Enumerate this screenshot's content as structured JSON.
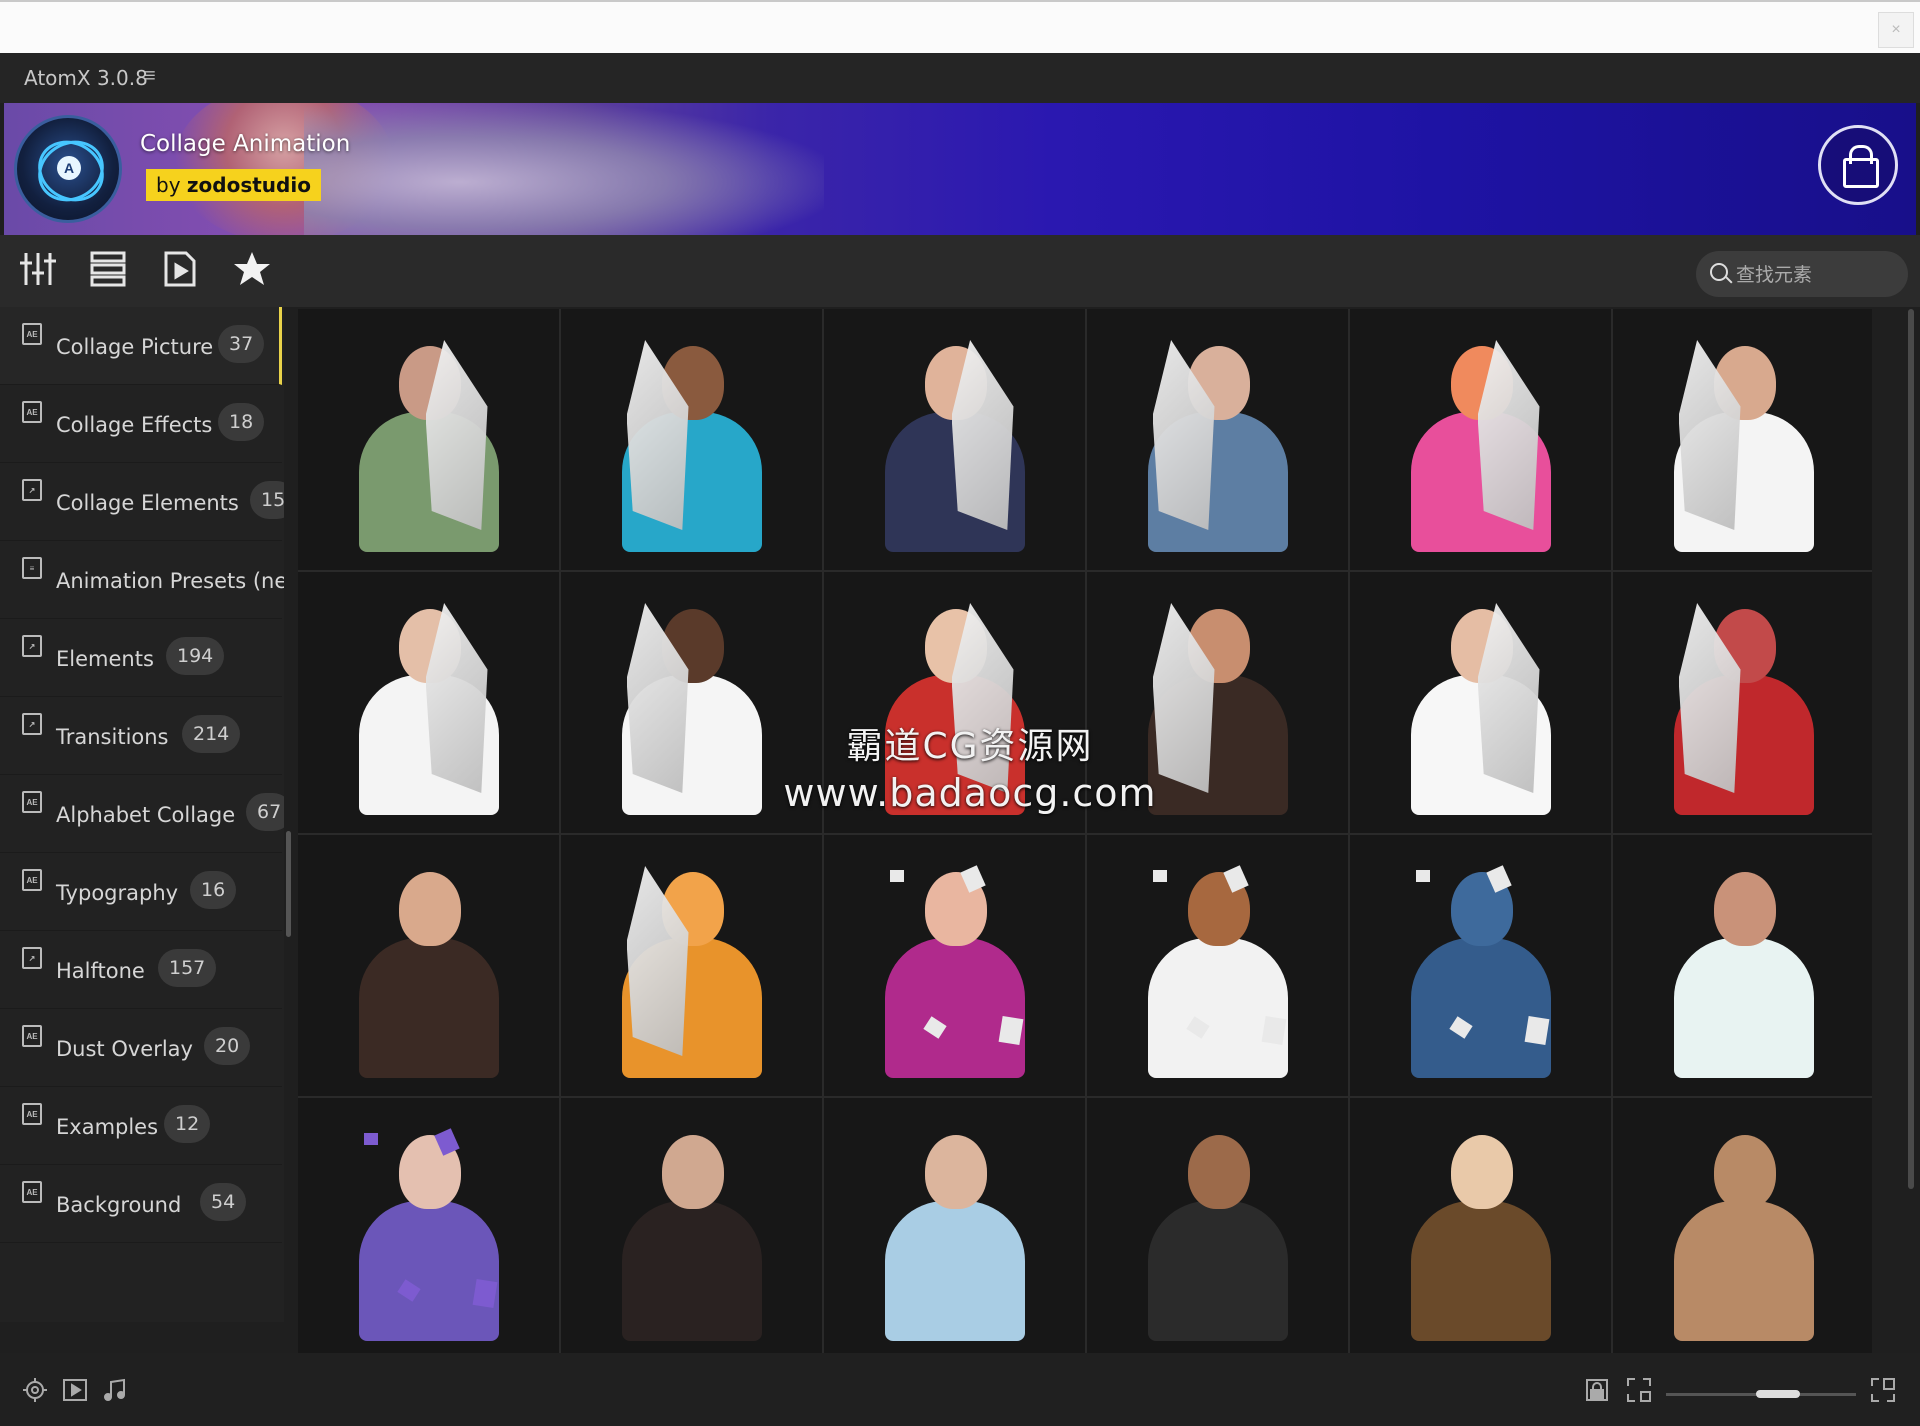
{
  "window": {
    "close_label": "×"
  },
  "app": {
    "title": "AtomX 3.0.8",
    "menu_glyph": "≡"
  },
  "banner": {
    "title": "Collage Animation",
    "by": "by",
    "author": "zodostudio",
    "logo_letter": "A"
  },
  "search": {
    "placeholder": "查找元素"
  },
  "categories": [
    {
      "label": "Collage Picture",
      "count": "37",
      "icon": "ae-file-icon"
    },
    {
      "label": "Collage Effects",
      "count": "18",
      "icon": "ae-file-icon"
    },
    {
      "label": "Collage Elements",
      "count": "15",
      "icon": "import-icon"
    },
    {
      "label": "Animation Presets (ne",
      "count": "",
      "icon": "document-icon"
    },
    {
      "label": "Elements",
      "count": "194",
      "icon": "import-icon"
    },
    {
      "label": "Transitions",
      "count": "214",
      "icon": "import-icon"
    },
    {
      "label": "Alphabet Collage",
      "count": "67",
      "icon": "ae-file-icon"
    },
    {
      "label": "Typography",
      "count": "16",
      "icon": "ae-file-icon"
    },
    {
      "label": "Halftone",
      "count": "157",
      "icon": "import-icon"
    },
    {
      "label": "Dust Overlay",
      "count": "20",
      "icon": "ae-file-icon"
    },
    {
      "label": "Examples",
      "count": "12",
      "icon": "ae-file-icon"
    },
    {
      "label": "Background",
      "count": "54",
      "icon": "ae-file-icon"
    }
  ],
  "watermark": {
    "line1": "霸道CG资源网",
    "line2": "www.badaocg.com"
  },
  "tiles": [
    {
      "skin": "#c99a86",
      "cloth": "#7a9a6e"
    },
    {
      "skin": "#8a5a3e",
      "cloth": "#27a7c9"
    },
    {
      "skin": "#e0b39a",
      "cloth": "#2f3557"
    },
    {
      "skin": "#d9b09b",
      "cloth": "#5d7ea3"
    },
    {
      "skin": "#f08a5d",
      "cloth": "#e84f9b"
    },
    {
      "skin": "#d8a98e",
      "cloth": "#f4f4f4"
    },
    {
      "skin": "#e4bfa8",
      "cloth": "#f4f4f4"
    },
    {
      "skin": "#5a3a2a",
      "cloth": "#f5f5f5"
    },
    {
      "skin": "#e8c2a8",
      "cloth": "#c9302c"
    },
    {
      "skin": "#c88e6f",
      "cloth": "#3a2a24"
    },
    {
      "skin": "#e5bda4",
      "cloth": "#f7f7f7"
    },
    {
      "skin": "#c24a4a",
      "cloth": "#c0282c"
    },
    {
      "skin": "#d9a98c",
      "cloth": "#3b2a24"
    },
    {
      "skin": "#f2a34a",
      "cloth": "#e8932b"
    },
    {
      "skin": "#e9b6a0",
      "cloth": "#b02a8c"
    },
    {
      "skin": "#a7683f",
      "cloth": "#f2f2f2"
    },
    {
      "skin": "#3e6a9c",
      "cloth": "#345c8c"
    },
    {
      "skin": "#c99279",
      "cloth": "#e8f3f2"
    },
    {
      "skin": "#e4c0b0",
      "cloth": "#6b56b9"
    },
    {
      "skin": "#d0a890",
      "cloth": "#2a2221"
    },
    {
      "skin": "#dcb59d",
      "cloth": "#a9cde4"
    },
    {
      "skin": "#9c6a4a",
      "cloth": "#2b2b2b"
    },
    {
      "skin": "#e9c9a9",
      "cloth": "#6a4a2a"
    },
    {
      "skin": "#b88a66",
      "cloth": "#b88a66"
    }
  ]
}
